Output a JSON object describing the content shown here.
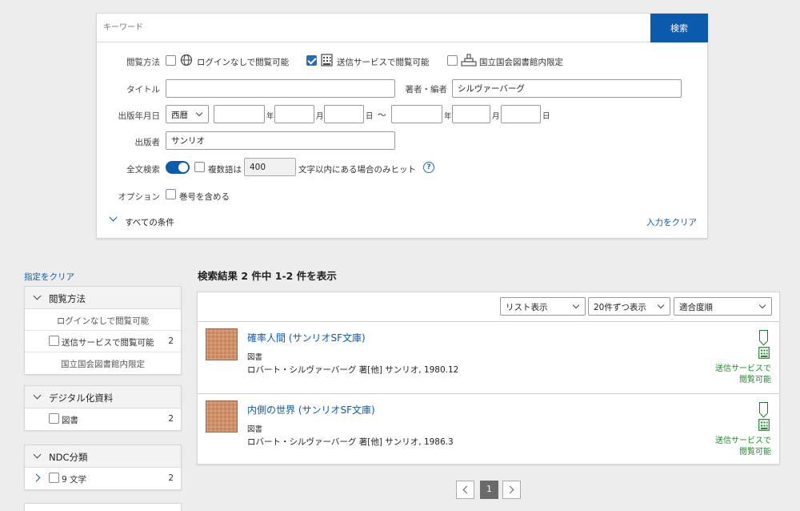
{
  "search": {
    "keyword_placeholder": "キーワード",
    "search_button": "検索",
    "view_method_label": "閲覧方法",
    "view_options": [
      {
        "label": "ログインなしで閲覧可能",
        "checked": false,
        "icon": "globe-icon"
      },
      {
        "label": "送信サービスで閲覧可能",
        "checked": true,
        "icon": "building-icon"
      },
      {
        "label": "国立国会図書館内限定",
        "checked": false,
        "icon": "library-icon"
      }
    ],
    "title_label": "タイトル",
    "title_value": "",
    "author_label": "著者・編者",
    "author_value": "シルヴァーバーグ",
    "pubdate_label": "出版年月日",
    "era_value": "西暦",
    "unit_year": "年",
    "unit_month": "月",
    "unit_day": "日",
    "range_sep": "〜",
    "publisher_label": "出版者",
    "publisher_value": "サンリオ",
    "fulltext_label": "全文検索",
    "fulltext_enabled": true,
    "multiword_label": "複数語は",
    "multiword_checked": false,
    "distance_value": "400",
    "distance_suffix": "文字以内にある場合のみヒット",
    "help_glyph": "?",
    "option_label": "オプション",
    "include_volume_label": "巻号を含める",
    "include_volume_checked": false,
    "all_conditions_label": "すべての条件",
    "clear_input_label": "入力をクリア"
  },
  "sidebar": {
    "clear_label": "指定をクリア",
    "facets": [
      {
        "title": "閲覧方法",
        "items": [
          {
            "label": "ログインなしで閲覧可能",
            "count": ""
          },
          {
            "label": "送信サービスで閲覧可能",
            "count": "2"
          },
          {
            "label": "国立国会図書館内限定",
            "count": ""
          }
        ]
      },
      {
        "title": "デジタル化資料",
        "items": [
          {
            "label": "図書",
            "count": "2"
          }
        ]
      },
      {
        "title": "NDC分類",
        "items": [
          {
            "label": "9 文学",
            "count": "2"
          }
        ]
      }
    ]
  },
  "results": {
    "summary": "検索結果 2 件中 1-2 件を表示",
    "view_select": "リスト表示",
    "per_page_select": "20件ずつ表示",
    "sort_select": "適合度順",
    "items": [
      {
        "title": "確率人間 (サンリオSF文庫)",
        "type": "図書",
        "meta": "ロバート・シルヴァーバーグ 著[他] サンリオ, 1980.12",
        "status_line1": "送信サービスで",
        "status_line2": "閲覧可能"
      },
      {
        "title": "内側の世界 (サンリオSF文庫)",
        "type": "図書",
        "meta": "ロバート・シルヴァーバーグ 著[他] サンリオ, 1986.3",
        "status_line1": "送信サービスで",
        "status_line2": "閲覧可能"
      }
    ]
  },
  "pagination": {
    "current_page": "1"
  },
  "colors": {
    "accent": "#0a5aad",
    "status_green": "#1d8a2e",
    "background": "#ededed"
  }
}
